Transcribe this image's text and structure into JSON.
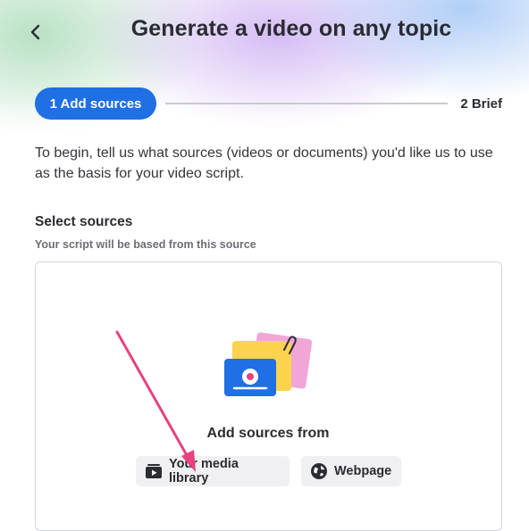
{
  "header": {
    "title": "Generate a video on any topic",
    "back_icon": "chevron-left-icon"
  },
  "stepper": {
    "steps": [
      {
        "label": "1 Add sources",
        "active": true
      },
      {
        "label": "2 Brief",
        "active": false
      }
    ],
    "active_color": "#1f6fe5"
  },
  "intro_text": "To begin, tell us what sources (videos or documents) you'd like us to use as the basis for your video script.",
  "sources": {
    "title": "Select sources",
    "subtitle": "Your script will be based from this source",
    "add_from_label": "Add sources from",
    "buttons": [
      {
        "label": "Your media library",
        "icon": "media-library-icon"
      },
      {
        "label": "Webpage",
        "icon": "globe-icon"
      }
    ]
  },
  "annotation": {
    "arrow_color": "#e8417f"
  }
}
